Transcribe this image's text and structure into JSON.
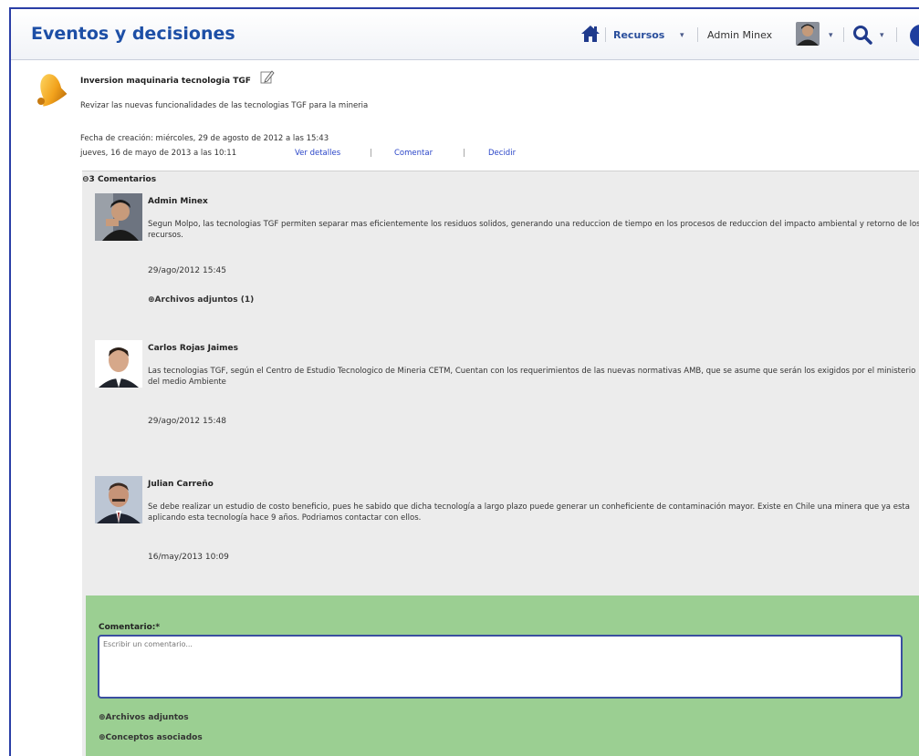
{
  "header": {
    "title": "Eventos y decisiones",
    "resources_label": "Recursos",
    "user_name": "Admin Minex",
    "caret": "▾"
  },
  "event": {
    "title": "Inversion maquinaria tecnologia TGF",
    "description": "Revizar las nuevas funcionalidades de las tecnologias TGF para la mineria",
    "created": "Fecha de creación: miércoles, 29 de agosto de 2012 a las 15:43",
    "date": "jueves, 16 de mayo de 2013 a las 10:11",
    "actions": {
      "details": "Ver detalles",
      "comment": "Comentar",
      "decide": "Decidir",
      "separator": "|"
    }
  },
  "comments": {
    "header": "3 Comentarios",
    "toggle": "⊖",
    "items": [
      {
        "author": "Admin Minex",
        "text": "Segun Molpo, las tecnologias TGF permiten separar mas eficientemente los residuos solidos, generando una reduccion de tiempo en los procesos de reduccion del impacto ambiental y retorno de los recursos.",
        "date": "29/ago/2012 15:45",
        "attachments": "Archivos adjuntos (1)"
      },
      {
        "author": "Carlos Rojas Jaimes",
        "text": "Las tecnologias TGF, según el Centro de Estudio Tecnologico de Mineria CETM, Cuentan con los requerimientos de las nuevas normativas AMB, que se asume que serán los exigidos por el ministerio del medio Ambiente",
        "date": "29/ago/2012 15:48"
      },
      {
        "author": "Julian Carreño",
        "text": "Se debe realizar un estudio de costo beneficio, pues he sabido que dicha tecnología a largo plazo puede generar un conheficiente de contaminación mayor. Existe en Chile una minera que ya esta aplicando esta tecnología hace 9 años. Podriamos contactar con ellos.",
        "date": "16/may/2013 10:09"
      }
    ]
  },
  "form": {
    "label": "Comentario:*",
    "placeholder": "Escribir un comentario...",
    "attachments": "Archivos adjuntos",
    "concepts": "Conceptos asociados",
    "bullet": "⊕"
  },
  "colors": {
    "title_blue": "#1d4fa6",
    "form_green": "#9bcf92",
    "link_blue": "#2a45c8"
  }
}
